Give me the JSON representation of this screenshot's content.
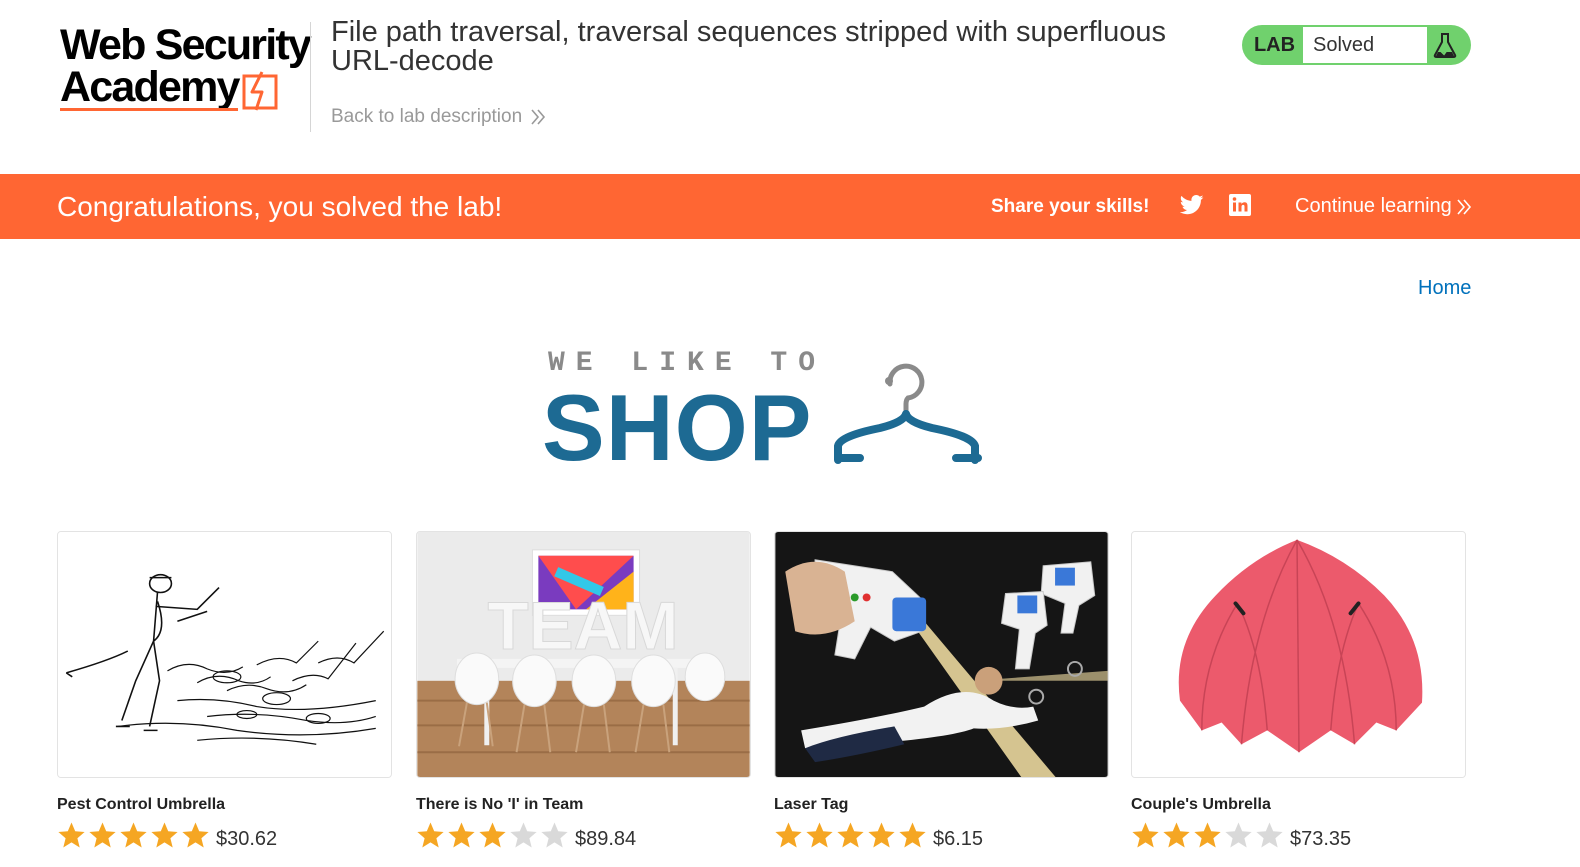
{
  "brand": {
    "logo_line1": "Web Security",
    "logo_line2": "Academy",
    "accent": "#ff6633"
  },
  "lab": {
    "title": "File path traversal, traversal sequences stripped with superfluous URL-decode",
    "back_label": "Back to lab description",
    "status_tag": "LAB",
    "status_text": "Solved",
    "status_color": "#70d16d"
  },
  "banner": {
    "message": "Congratulations, you solved the lab!",
    "share_label": "Share your skills!",
    "share_icons": [
      "twitter-icon",
      "linkedin-icon"
    ],
    "continue_label": "Continue learning"
  },
  "nav": {
    "home_label": "Home"
  },
  "shop_logo": {
    "top_text": "WE LIKE TO",
    "main_text": "SHOP",
    "icon": "hanger-icon",
    "color": "#1d6a93"
  },
  "products": [
    {
      "name": "Pest Control Umbrella",
      "rating": 5,
      "price": "$30.62",
      "image": "pest-control-umbrella-image"
    },
    {
      "name": "There is No 'I' in Team",
      "rating": 3,
      "price": "$89.84",
      "image": "team-image"
    },
    {
      "name": "Laser Tag",
      "rating": 5,
      "price": "$6.15",
      "image": "laser-tag-image"
    },
    {
      "name": "Couple's Umbrella",
      "rating": 3,
      "price": "$73.35",
      "image": "couples-umbrella-image"
    }
  ],
  "rating_max": 5,
  "star_colors": {
    "filled": "#f5a623",
    "empty": "#d9d9d9"
  }
}
